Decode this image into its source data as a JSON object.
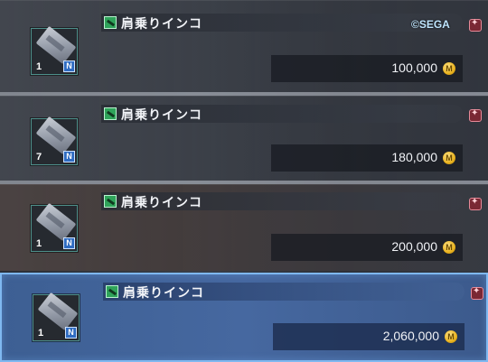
{
  "copyright": "©SEGA",
  "items": [
    {
      "name": "肩乗りインコ",
      "quantity": "1",
      "price": "100,000",
      "selected": false
    },
    {
      "name": "肩乗りインコ",
      "quantity": "7",
      "price": "180,000",
      "selected": false
    },
    {
      "name": "肩乗りインコ",
      "quantity": "1",
      "price": "200,000",
      "selected": false
    },
    {
      "name": "肩乗りインコ",
      "quantity": "1",
      "price": "2,060,000",
      "selected": true
    }
  ],
  "icons": {
    "thumbnail": "pass-ticket-icon",
    "category": "item-category-icon",
    "tradable_badge": "n-badge-icon",
    "lock": "lock-icon",
    "currency": "meseta-coin-icon"
  },
  "colors": {
    "selected_bg": "#4668a0",
    "selected_border": "#7fb8f0",
    "coin": "#e9b21e",
    "category_icon": "#2fa35a"
  }
}
